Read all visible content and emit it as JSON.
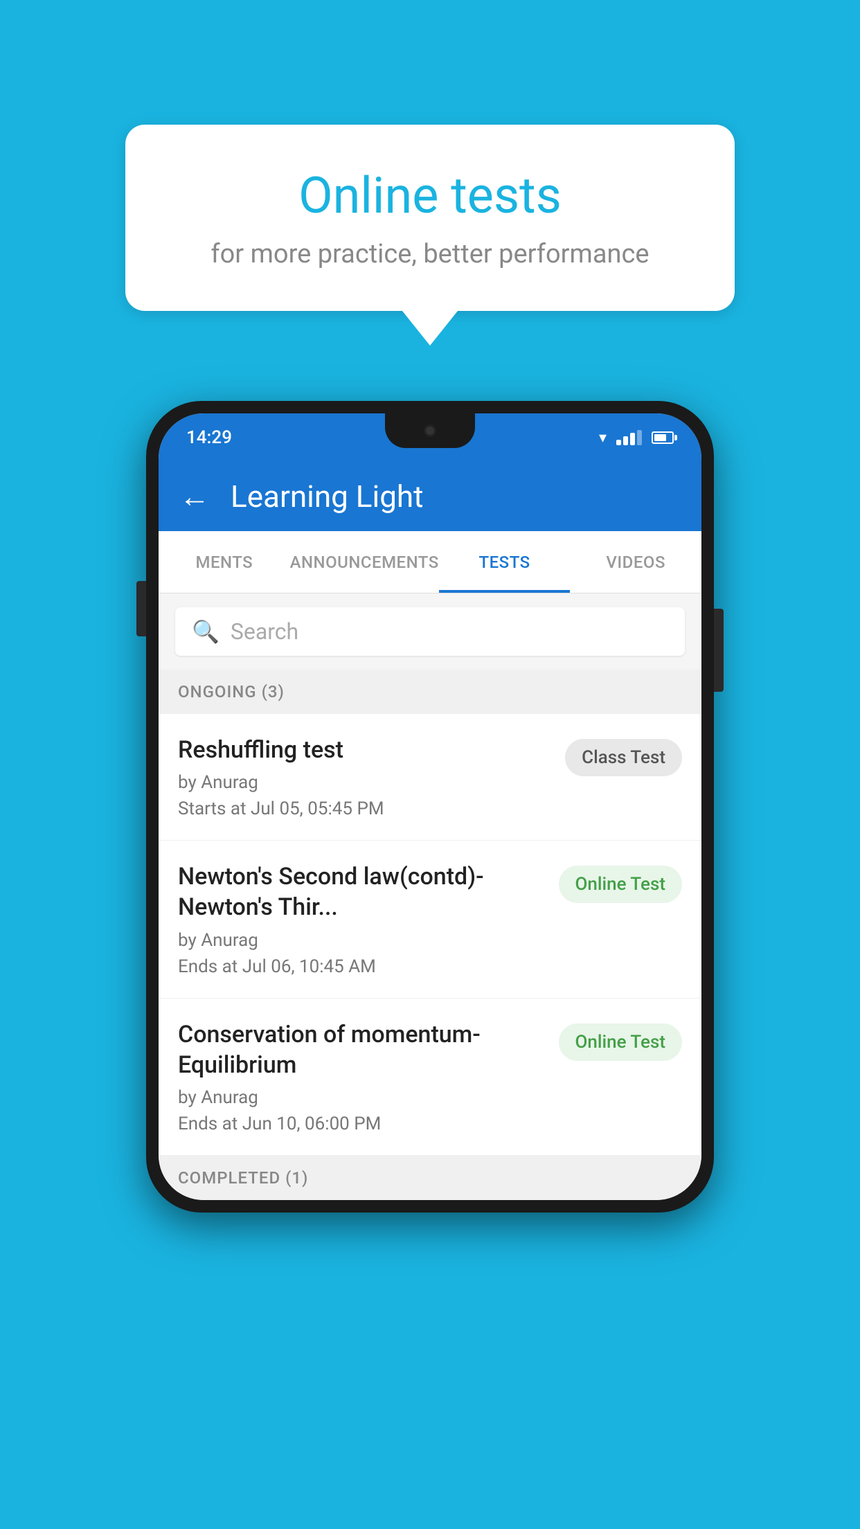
{
  "background": {
    "color": "#1ab3e0"
  },
  "speech_bubble": {
    "title": "Online tests",
    "subtitle": "for more practice, better performance"
  },
  "phone": {
    "status_bar": {
      "time": "14:29",
      "wifi": true,
      "signal": true,
      "battery": true
    },
    "app_bar": {
      "title": "Learning Light",
      "back_label": "←"
    },
    "tabs": [
      {
        "label": "MENTS",
        "active": false
      },
      {
        "label": "ANNOUNCEMENTS",
        "active": false
      },
      {
        "label": "TESTS",
        "active": true
      },
      {
        "label": "VIDEOS",
        "active": false
      }
    ],
    "search": {
      "placeholder": "Search"
    },
    "ongoing_section": {
      "header": "ONGOING (3)",
      "items": [
        {
          "title": "Reshuffling test",
          "author": "by Anurag",
          "date": "Starts at  Jul 05, 05:45 PM",
          "badge": "Class Test",
          "badge_type": "class"
        },
        {
          "title": "Newton's Second law(contd)-Newton's Thir...",
          "author": "by Anurag",
          "date": "Ends at  Jul 06, 10:45 AM",
          "badge": "Online Test",
          "badge_type": "online"
        },
        {
          "title": "Conservation of momentum-Equilibrium",
          "author": "by Anurag",
          "date": "Ends at  Jun 10, 06:00 PM",
          "badge": "Online Test",
          "badge_type": "online"
        }
      ]
    },
    "completed_section": {
      "header": "COMPLETED (1)"
    }
  }
}
